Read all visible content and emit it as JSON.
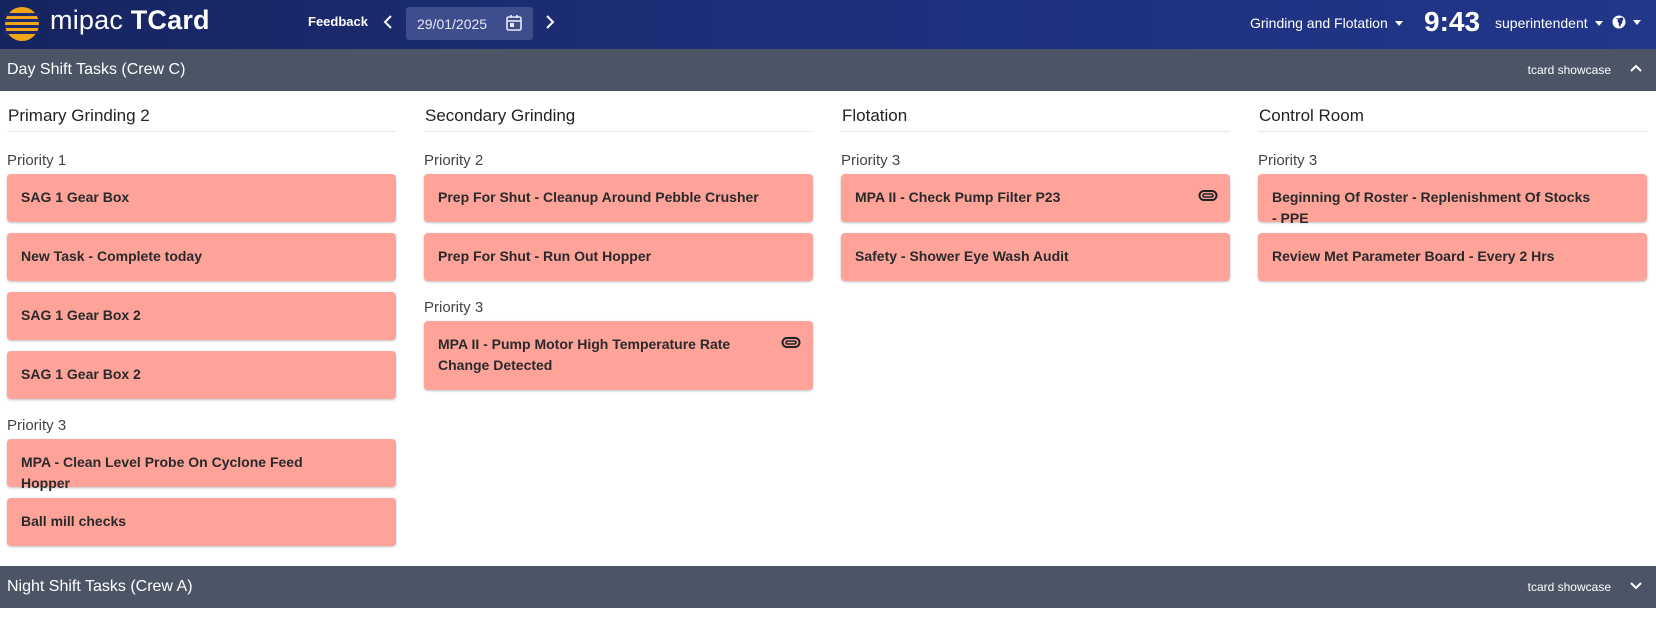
{
  "header": {
    "brand_prefix": "mipac",
    "brand_suffix": "TCard",
    "feedback_label": "Feedback",
    "date": "29/01/2025",
    "site": "Grinding and Flotation",
    "clock": "9:43",
    "user": "superintendent",
    "prev_icon": "chevron-left-icon",
    "next_icon": "chevron-right-icon",
    "calendar_icon": "calendar-icon",
    "globe_icon": "globe-icon"
  },
  "day_shift": {
    "title": "Day Shift Tasks (Crew C)",
    "showcase": "tcard showcase",
    "columns": [
      {
        "title": "Primary Grinding 2",
        "groups": [
          {
            "priority": "Priority 1",
            "tasks": [
              {
                "label": "SAG 1 Gear Box",
                "attachment": false
              },
              {
                "label": "New Task - Complete today",
                "attachment": false
              },
              {
                "label": "SAG 1 Gear Box 2",
                "attachment": false
              },
              {
                "label": "SAG 1 Gear Box 2",
                "attachment": false
              }
            ]
          },
          {
            "priority": "Priority 3",
            "tasks": [
              {
                "label": "MPA - Clean Level Probe On Cyclone Feed Hopper",
                "attachment": false
              },
              {
                "label": "Ball mill checks",
                "attachment": false
              }
            ]
          }
        ]
      },
      {
        "title": "Secondary Grinding",
        "groups": [
          {
            "priority": "Priority 2",
            "tasks": [
              {
                "label": "Prep For Shut - Cleanup Around Pebble Crusher",
                "attachment": false
              },
              {
                "label": "Prep For Shut - Run Out Hopper",
                "attachment": false
              }
            ]
          },
          {
            "priority": "Priority 3",
            "tasks": [
              {
                "label": "MPA II - Pump Motor High Temperature Rate Change Detected",
                "attachment": true
              }
            ]
          }
        ]
      },
      {
        "title": "Flotation",
        "groups": [
          {
            "priority": "Priority 3",
            "tasks": [
              {
                "label": "MPA II - Check Pump Filter P23",
                "attachment": true
              },
              {
                "label": "Safety - Shower Eye Wash Audit",
                "attachment": false
              }
            ]
          }
        ]
      },
      {
        "title": "Control Room",
        "groups": [
          {
            "priority": "Priority 3",
            "tasks": [
              {
                "label": "Beginning Of Roster - Replenishment Of Stocks - PPE",
                "attachment": false
              },
              {
                "label": "Review Met Parameter Board - Every 2 Hrs",
                "attachment": false
              }
            ]
          }
        ]
      }
    ]
  },
  "night_shift": {
    "title": "Night Shift Tasks (Crew A)",
    "showcase": "tcard showcase"
  },
  "colors": {
    "topbar": "#1d2f7a",
    "shift_bar": "#4b5566",
    "task_card": "#fda39a",
    "logo_orange": "#f2a516"
  }
}
